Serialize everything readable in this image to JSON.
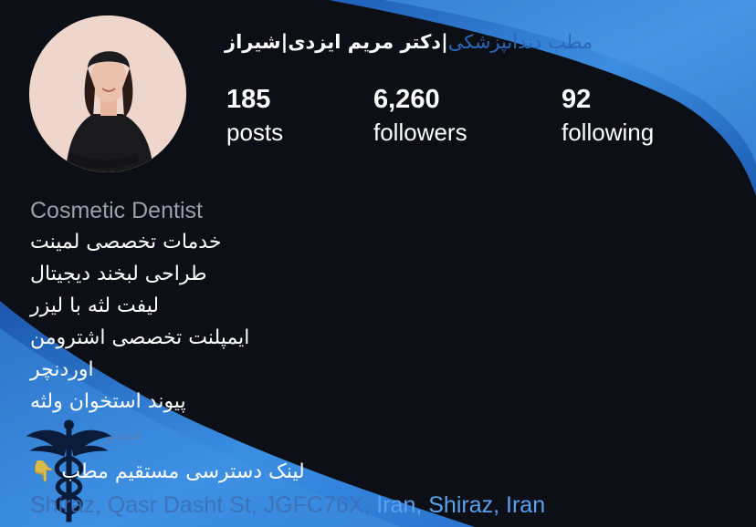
{
  "profile": {
    "name_faded": "مطب دندانپزشکی",
    "name_main": "|دکتر مریم ایزدی|شیراز"
  },
  "stats": [
    {
      "value": "185",
      "label": "posts"
    },
    {
      "value": "6,260",
      "label": "followers"
    },
    {
      "value": "92",
      "label": "following"
    }
  ],
  "bio": {
    "category": "Cosmetic Dentist",
    "lines": [
      "خدمات تخصصی لمینت",
      "طراحی لبخند دیجیتال",
      "لیفت لثه با لیزر",
      "ایمپلنت تخصصی اشترومن",
      "اوردنچر",
      "پیوند استخوان ولثه",
      "سینوس لیفت"
    ],
    "link_text": "لینک دسترسی مستقیم مطب",
    "link_text_tail": "👇"
  },
  "address": {
    "faded_part": "Shiraz, Qasr Dasht St, JGFC76X,",
    "bright_part": " Iran, Shiraz, Iran"
  },
  "colors": {
    "background": "#0c0f15",
    "accent_blue": "#2f7fd6",
    "link_blue": "#5aa2f0"
  },
  "icons": {
    "overlay": "caduceus-icon"
  }
}
